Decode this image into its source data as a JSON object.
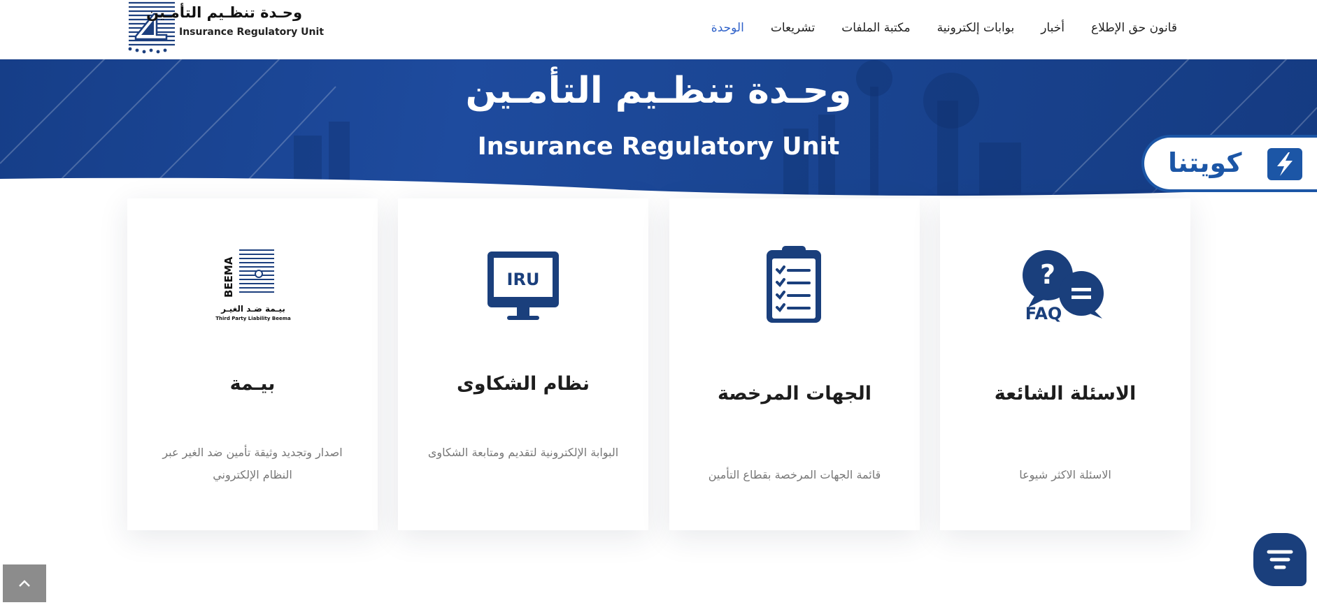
{
  "header": {
    "logo": {
      "title_ar": "وحـدة تنظـيم التأمـين",
      "title_en": "Insurance Regulatory Unit"
    },
    "nav": [
      {
        "label": "الوحدة",
        "active": true
      },
      {
        "label": "تشريعات",
        "active": false
      },
      {
        "label": "مكتبة الملفات",
        "active": false
      },
      {
        "label": "بوابات إلكترونية",
        "active": false
      },
      {
        "label": "أخبار",
        "active": false
      },
      {
        "label": "قانون حق الإطلاع",
        "active": false
      }
    ]
  },
  "banner": {
    "title_ar": "وحـدة تنظـيم التأمـين",
    "title_en": "Insurance Regulatory Unit",
    "badge_label": "كويتنا"
  },
  "cards": [
    {
      "title": "بيـمة",
      "description": "اصدار وتجديد وثيقة تأمين ضد الغير عبر النظام الإلكتروني",
      "icon": "beema-logo-icon",
      "icon_text": "BEEMA",
      "icon_caption_ar": "بيـمة ضـد الغيـر",
      "icon_caption_en": "Third Party Liability Beema"
    },
    {
      "title": "نظام الشكاوى",
      "description": "البوابة الإلكترونية لتقديم ومتابعة الشكاوى",
      "icon": "monitor-iru-icon",
      "icon_text": "IRU"
    },
    {
      "title": "الجهات المرخصة",
      "description": "قائمة الجهات المرخصة بقطاع التأمين",
      "icon": "clipboard-checklist-icon"
    },
    {
      "title": "الاسئلة الشائعة",
      "description": "الاسئلة الاكثر شيوعا",
      "icon": "faq-bubble-icon",
      "icon_text": "FAQ"
    }
  ],
  "colors": {
    "primary": "#1a3f7c",
    "banner": "#1e4b9e",
    "nav_active": "#2f62c9",
    "kuwaitna": "#1c56a6"
  },
  "icons": {
    "scroll_top": "chevron-up-icon",
    "chat": "chat-menu-icon"
  }
}
